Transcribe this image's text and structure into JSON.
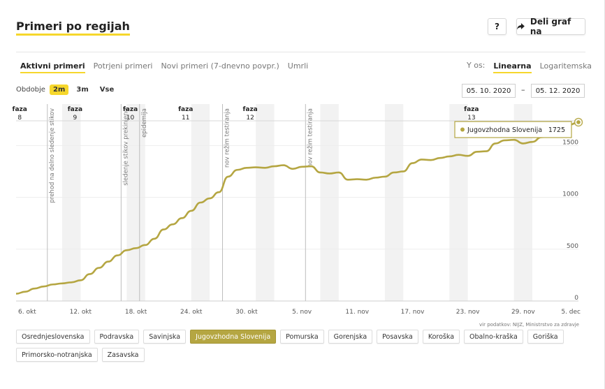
{
  "header": {
    "title": "Primeri po regijah",
    "help_label": "?",
    "share_label": "Deli graf na"
  },
  "tabs": [
    {
      "label": "Aktivni primeri",
      "active": true
    },
    {
      "label": "Potrjeni primeri",
      "active": false
    },
    {
      "label": "Novi primeri (7-dnevno povpr.)",
      "active": false
    },
    {
      "label": "Umrli",
      "active": false
    }
  ],
  "yaxis_control": {
    "label": "Y os:",
    "options": [
      {
        "label": "Linearna",
        "active": true
      },
      {
        "label": "Logaritemska",
        "active": false
      }
    ]
  },
  "period": {
    "label": "Obdobje",
    "options": [
      {
        "label": "2m",
        "active": true
      },
      {
        "label": "3m",
        "active": false
      },
      {
        "label": "Vse",
        "active": false
      }
    ],
    "date_from": "05. 10. 2020",
    "date_sep": "–",
    "date_to": "05. 12. 2020"
  },
  "chart_data": {
    "type": "line",
    "x_labels": [
      "6. okt",
      "12. okt",
      "18. okt",
      "24. okt",
      "30. okt",
      "5. nov",
      "11. nov",
      "17. nov",
      "23. nov",
      "29. nov",
      "5. dec"
    ],
    "y_ticks": [
      0,
      500,
      1000,
      1500
    ],
    "ylim": [
      0,
      1900
    ],
    "xlim": [
      "2020-10-05",
      "2020-12-05"
    ],
    "series": [
      {
        "name": "Jugovzhodna Slovenija",
        "color": "#b5a642",
        "x": [
          "2020-10-05",
          "2020-10-06",
          "2020-10-07",
          "2020-10-08",
          "2020-10-09",
          "2020-10-10",
          "2020-10-11",
          "2020-10-12",
          "2020-10-13",
          "2020-10-14",
          "2020-10-15",
          "2020-10-16",
          "2020-10-17",
          "2020-10-18",
          "2020-10-19",
          "2020-10-20",
          "2020-10-21",
          "2020-10-22",
          "2020-10-23",
          "2020-10-24",
          "2020-10-25",
          "2020-10-26",
          "2020-10-27",
          "2020-10-28",
          "2020-10-29",
          "2020-10-30",
          "2020-10-31",
          "2020-11-01",
          "2020-11-02",
          "2020-11-03",
          "2020-11-04",
          "2020-11-05",
          "2020-11-06",
          "2020-11-07",
          "2020-11-08",
          "2020-11-09",
          "2020-11-10",
          "2020-11-11",
          "2020-11-12",
          "2020-11-13",
          "2020-11-14",
          "2020-11-15",
          "2020-11-16",
          "2020-11-17",
          "2020-11-18",
          "2020-11-19",
          "2020-11-20",
          "2020-11-21",
          "2020-11-22",
          "2020-11-23",
          "2020-11-24",
          "2020-11-25",
          "2020-11-26",
          "2020-11-27",
          "2020-11-28",
          "2020-11-29",
          "2020-11-30",
          "2020-12-01",
          "2020-12-02",
          "2020-12-03",
          "2020-12-04",
          "2020-12-05"
        ],
        "values": [
          70,
          90,
          120,
          140,
          160,
          170,
          180,
          200,
          260,
          320,
          380,
          440,
          490,
          510,
          540,
          600,
          690,
          740,
          800,
          870,
          950,
          990,
          1050,
          1200,
          1265,
          1285,
          1290,
          1285,
          1300,
          1310,
          1275,
          1295,
          1300,
          1240,
          1230,
          1240,
          1170,
          1175,
          1170,
          1190,
          1200,
          1240,
          1250,
          1330,
          1365,
          1360,
          1380,
          1395,
          1410,
          1400,
          1440,
          1445,
          1520,
          1550,
          1555,
          1520,
          1535,
          1580,
          1600,
          1650,
          1700,
          1725
        ]
      }
    ],
    "phases": [
      {
        "label1": "faza",
        "label2": "8",
        "date": "2020-10-06"
      },
      {
        "label1": "faza",
        "label2": "9",
        "date": "2020-10-12"
      },
      {
        "label1": "faza",
        "label2": "10",
        "date": "2020-10-18"
      },
      {
        "label1": "faza",
        "label2": "11",
        "date": "2020-10-24"
      },
      {
        "label1": "faza",
        "label2": "12",
        "date": "2020-10-31"
      },
      {
        "label1": "faza",
        "label2": "13",
        "date": "2020-11-24"
      }
    ],
    "events": [
      {
        "label": "prehod na delno sledenje stikov",
        "date": "2020-10-09"
      },
      {
        "label": "sledenje stikov prekinjeno",
        "date": "2020-10-17"
      },
      {
        "label": "epidemija",
        "date": "2020-10-19"
      },
      {
        "label": "nov režim testiranja",
        "date": "2020-10-28"
      },
      {
        "label": "nov režim testiranja",
        "date": "2020-11-06"
      }
    ],
    "weekends": [
      "2020-10-10",
      "2020-10-17",
      "2020-10-24",
      "2020-10-31",
      "2020-11-07",
      "2020-11-14",
      "2020-11-21",
      "2020-11-28"
    ],
    "tooltip": {
      "name": "Jugovzhodna Slovenija",
      "value": "1725"
    },
    "source": "vir podatkov: NIJZ, Ministrstvo za zdravje"
  },
  "regions": [
    {
      "label": "Osrednjeslovenska",
      "active": false
    },
    {
      "label": "Podravska",
      "active": false
    },
    {
      "label": "Savinjska",
      "active": false
    },
    {
      "label": "Jugovzhodna Slovenija",
      "active": true
    },
    {
      "label": "Pomurska",
      "active": false
    },
    {
      "label": "Gorenjska",
      "active": false
    },
    {
      "label": "Posavska",
      "active": false
    },
    {
      "label": "Koroška",
      "active": false
    },
    {
      "label": "Obalno-kraška",
      "active": false
    },
    {
      "label": "Goriška",
      "active": false
    },
    {
      "label": "Primorsko-notranjska",
      "active": false
    },
    {
      "label": "Zasavska",
      "active": false
    }
  ]
}
